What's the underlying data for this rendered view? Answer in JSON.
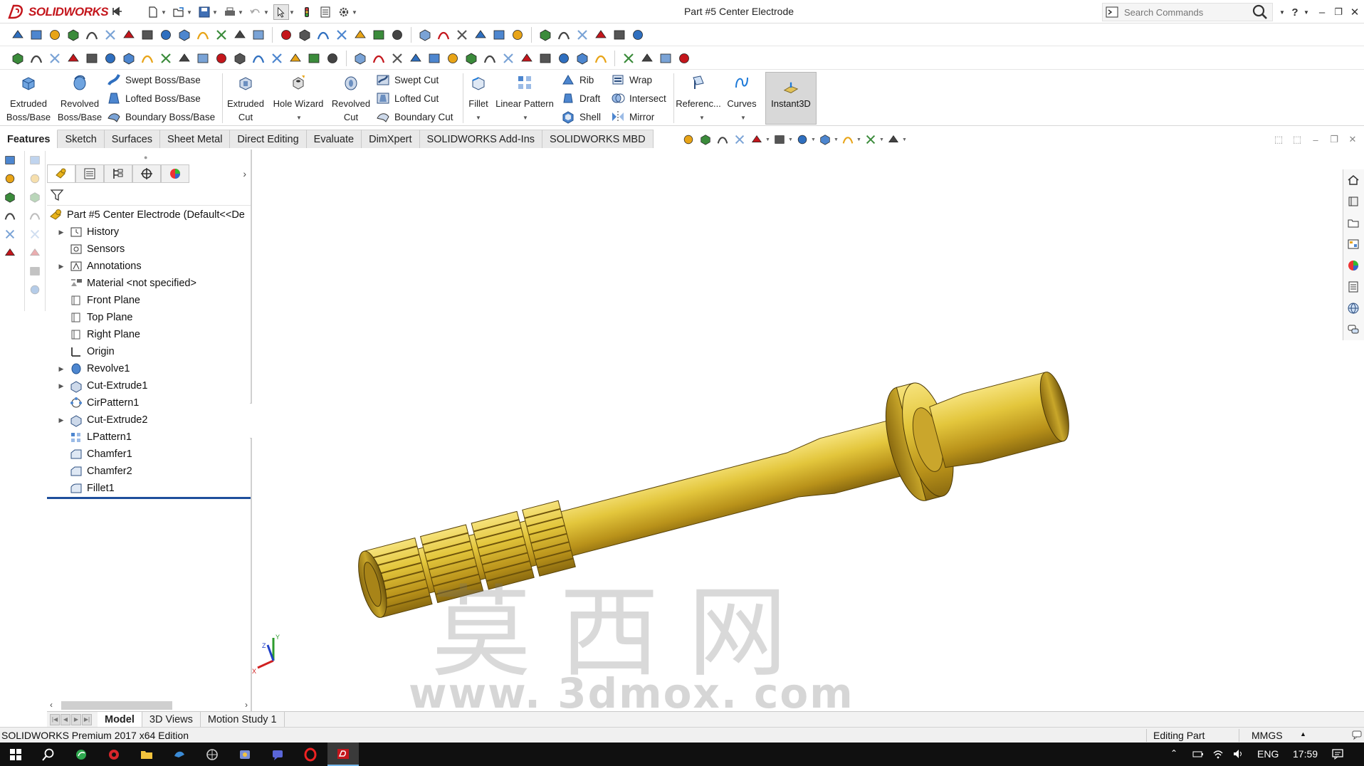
{
  "app": {
    "brand": "SOLIDWORKS",
    "document_title": "Part #5 Center Electrode",
    "search_placeholder": "Search Commands",
    "help_label": "?"
  },
  "command_manager": {
    "extruded_boss": [
      "Extruded",
      "Boss/Base"
    ],
    "revolved_boss": [
      "Revolved",
      "Boss/Base"
    ],
    "swept_boss": "Swept Boss/Base",
    "lofted_boss": "Lofted Boss/Base",
    "boundary_boss": "Boundary Boss/Base",
    "extruded_cut": [
      "Extruded",
      "Cut"
    ],
    "hole_wizard": "Hole Wizard",
    "revolved_cut": [
      "Revolved",
      "Cut"
    ],
    "swept_cut": "Swept Cut",
    "lofted_cut": "Lofted Cut",
    "boundary_cut": "Boundary Cut",
    "fillet": "Fillet",
    "linear_pattern": "Linear Pattern",
    "rib": "Rib",
    "draft": "Draft",
    "shell": "Shell",
    "wrap": "Wrap",
    "intersect": "Intersect",
    "mirror": "Mirror",
    "reference": "Referenc...",
    "curves": "Curves",
    "instant3d": "Instant3D"
  },
  "tabs": [
    {
      "label": "Features",
      "active": true
    },
    {
      "label": "Sketch"
    },
    {
      "label": "Surfaces"
    },
    {
      "label": "Sheet Metal"
    },
    {
      "label": "Direct Editing"
    },
    {
      "label": "Evaluate"
    },
    {
      "label": "DimXpert"
    },
    {
      "label": "SOLIDWORKS Add-Ins"
    },
    {
      "label": "SOLIDWORKS MBD"
    }
  ],
  "feature_tree": {
    "root": "Part #5 Center Electrode  (Default<<De",
    "items": [
      {
        "label": "History",
        "expandable": true
      },
      {
        "label": "Sensors",
        "expandable": false
      },
      {
        "label": "Annotations",
        "expandable": true
      },
      {
        "label": "Material <not specified>",
        "expandable": false
      },
      {
        "label": "Front Plane",
        "expandable": false
      },
      {
        "label": "Top Plane",
        "expandable": false
      },
      {
        "label": "Right Plane",
        "expandable": false
      },
      {
        "label": "Origin",
        "expandable": false
      },
      {
        "label": "Revolve1",
        "expandable": true
      },
      {
        "label": "Cut-Extrude1",
        "expandable": true
      },
      {
        "label": "CirPattern1",
        "expandable": false
      },
      {
        "label": "Cut-Extrude2",
        "expandable": true
      },
      {
        "label": "LPattern1",
        "expandable": false
      },
      {
        "label": "Chamfer1",
        "expandable": false
      },
      {
        "label": "Chamfer2",
        "expandable": false
      },
      {
        "label": "Fillet1",
        "expandable": false
      }
    ]
  },
  "viewport": {
    "watermark_cn": "莫西网",
    "watermark_url": "www. 3dmox. com",
    "triad": {
      "x": "X",
      "y": "Y",
      "z": "Z"
    },
    "part_color": "#d4b527"
  },
  "bottom_tabs": [
    {
      "label": "Model",
      "active": true
    },
    {
      "label": "3D Views"
    },
    {
      "label": "Motion Study 1"
    }
  ],
  "status_bar": {
    "edition": "SOLIDWORKS Premium 2017 x64 Edition",
    "mode": "Editing Part",
    "units": "MMGS"
  },
  "taskbar": {
    "language": "ENG",
    "clock": "17:59"
  },
  "colors": {
    "brand_red": "#c4161c",
    "selection_blue": "#1e4f9c",
    "taskbar": "#101010"
  }
}
